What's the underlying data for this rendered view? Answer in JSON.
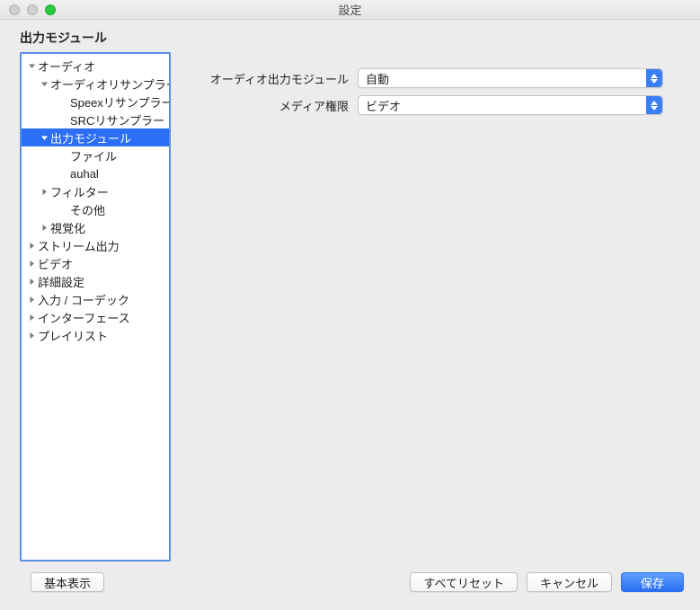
{
  "window": {
    "title": "設定"
  },
  "section": {
    "title": "出力モジュール"
  },
  "sidebar": {
    "items": [
      {
        "label": "オーディオ",
        "indent": 0,
        "arrow": "down",
        "selected": false
      },
      {
        "label": "オーディオリサンプラー",
        "indent": 1,
        "arrow": "down",
        "selected": false
      },
      {
        "label": "Speexリサンプラー",
        "indent": 2,
        "arrow": "",
        "selected": false
      },
      {
        "label": "SRCリサンプラー",
        "indent": 2,
        "arrow": "",
        "selected": false
      },
      {
        "label": "出力モジュール",
        "indent": 1,
        "arrow": "down",
        "selected": true
      },
      {
        "label": "ファイル",
        "indent": 2,
        "arrow": "",
        "selected": false
      },
      {
        "label": "auhal",
        "indent": 2,
        "arrow": "",
        "selected": false
      },
      {
        "label": "フィルター",
        "indent": 1,
        "arrow": "right",
        "selected": false
      },
      {
        "label": "その他",
        "indent": 2,
        "arrow": "",
        "selected": false
      },
      {
        "label": "視覚化",
        "indent": 1,
        "arrow": "right",
        "selected": false
      },
      {
        "label": "ストリーム出力",
        "indent": 0,
        "arrow": "right",
        "selected": false
      },
      {
        "label": "ビデオ",
        "indent": 0,
        "arrow": "right",
        "selected": false
      },
      {
        "label": "詳細設定",
        "indent": 0,
        "arrow": "right",
        "selected": false
      },
      {
        "label": "入力 / コーデック",
        "indent": 0,
        "arrow": "right",
        "selected": false
      },
      {
        "label": "インターフェース",
        "indent": 0,
        "arrow": "right",
        "selected": false
      },
      {
        "label": "プレイリスト",
        "indent": 0,
        "arrow": "right",
        "selected": false
      }
    ]
  },
  "form": {
    "audio_output_module": {
      "label": "オーディオ出力モジュール",
      "value": "自動"
    },
    "media_permission": {
      "label": "メディア権限",
      "value": "ビデオ"
    }
  },
  "footer": {
    "basic_view": "基本表示",
    "reset_all": "すべてリセット",
    "cancel": "キャンセル",
    "save": "保存"
  }
}
